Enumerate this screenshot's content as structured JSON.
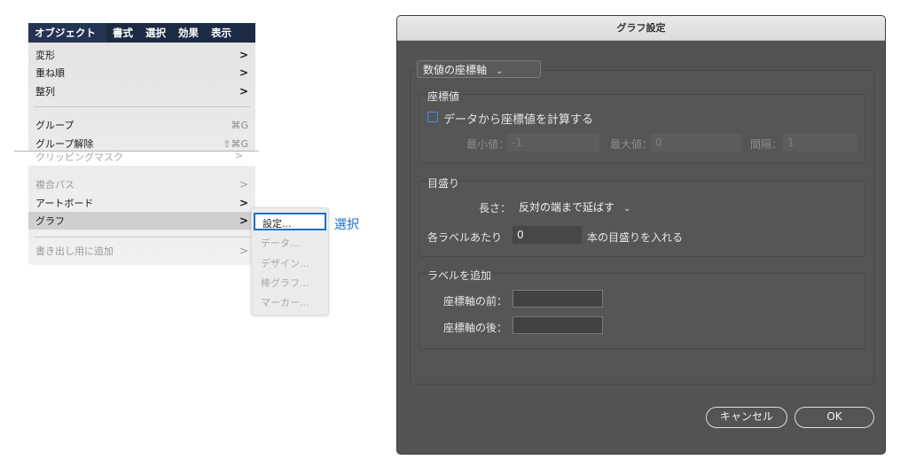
{
  "menubar": {
    "items": [
      "オブジェクト",
      "書式",
      "選択",
      "効果",
      "表示"
    ]
  },
  "menu": {
    "transform": "変形",
    "arrange": "重ね順",
    "align": "整列",
    "group": "グループ",
    "group_shortcut": "⌘G",
    "ungroup": "グループ解除",
    "ungroup_shortcut": "⇧⌘G",
    "cut_item": "クリッピングマスク",
    "compound_path": "複合パス",
    "artboards": "アートボード",
    "graph": "グラフ",
    "export_add": "書き出し用に追加",
    "arrow": ">"
  },
  "submenu": {
    "items": [
      "設定...",
      "データ...",
      "デザイン...",
      "棒グラフ...",
      "マーカー..."
    ]
  },
  "callout": "選択",
  "dialog": {
    "title": "グラフ設定",
    "axis_dropdown": "数値の座標軸",
    "values": {
      "heading": "座標値",
      "calc_checkbox": "データから座標値を計算する",
      "min_label": "最小値：",
      "min_value": "-1",
      "max_label": "最大値：",
      "max_value": "0",
      "interval_label": "間隔：",
      "interval_value": "1"
    },
    "ticks": {
      "heading": "目盛り",
      "length_label": "長さ：",
      "length_value": "反対の端まで延ばす",
      "per_label_prefix": "各ラベルあたり",
      "per_label_value": "0",
      "per_label_suffix": "本の目盛りを入れる"
    },
    "labels": {
      "heading": "ラベルを追加",
      "before_label": "座標軸の前：",
      "after_label": "座標軸の後：",
      "before_value": "",
      "after_value": ""
    },
    "cancel_button": "キャンセル",
    "ok_button": "OK"
  },
  "colors": {
    "accent": "#1f6fc4",
    "menubar": "#1d2a44",
    "dialog_bg": "#535353"
  }
}
